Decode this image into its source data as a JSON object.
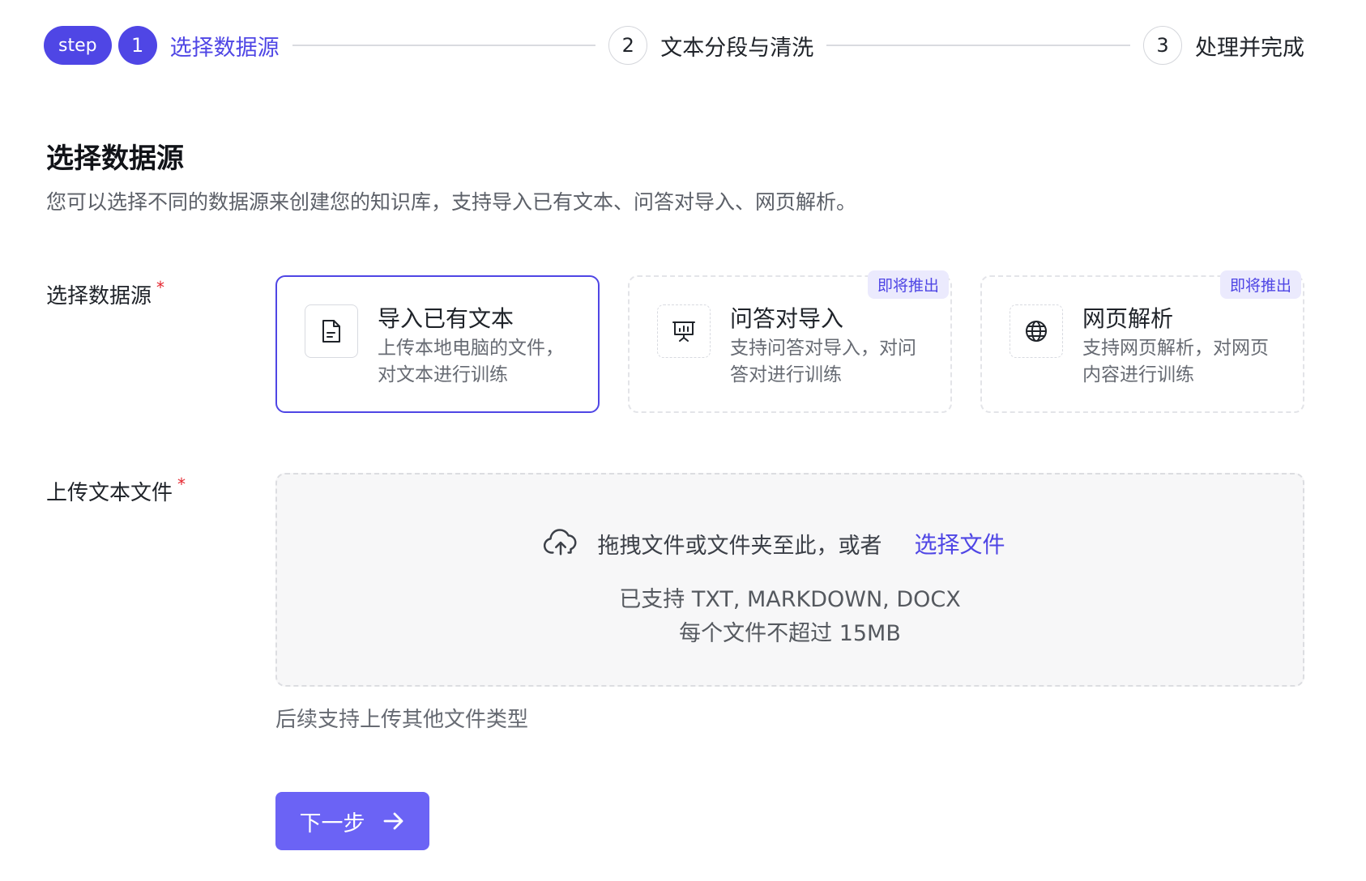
{
  "stepper": {
    "tag": "step",
    "steps": [
      {
        "number": "1",
        "label": "选择数据源",
        "state": "active"
      },
      {
        "number": "2",
        "label": "文本分段与清洗",
        "state": "upcoming"
      },
      {
        "number": "3",
        "label": "处理并完成",
        "state": "upcoming"
      }
    ]
  },
  "header": {
    "title": "选择数据源",
    "description": "您可以选择不同的数据源来创建您的知识库，支持导入已有文本、问答对导入、网页解析。"
  },
  "source_field": {
    "label": "选择数据源",
    "required_mark": "*",
    "options": [
      {
        "title": "导入已有文本",
        "description": "上传本地电脑的文件，对文本进行训练",
        "icon": "document-icon",
        "selected": true,
        "badge": ""
      },
      {
        "title": "问答对导入",
        "description": "支持问答对导入，对问答对进行训练",
        "icon": "presentation-chart-icon",
        "selected": false,
        "badge": "即将推出"
      },
      {
        "title": "网页解析",
        "description": "支持网页解析，对网页内容进行训练",
        "icon": "globe-icon",
        "selected": false,
        "badge": "即将推出"
      }
    ]
  },
  "upload_field": {
    "label": "上传文本文件",
    "required_mark": "*",
    "drop_text": "拖拽文件或文件夹至此，或者",
    "select_link": "选择文件",
    "formats": "已支持 TXT, MARKDOWN, DOCX",
    "limit": "每个文件不超过 15MB",
    "hint": "后续支持上传其他文件类型"
  },
  "actions": {
    "next_label": "下一步"
  },
  "colors": {
    "accent": "#4f46e5",
    "button": "#6b63f5",
    "required": "#e5262f",
    "badge_bg": "#ebeafd"
  }
}
